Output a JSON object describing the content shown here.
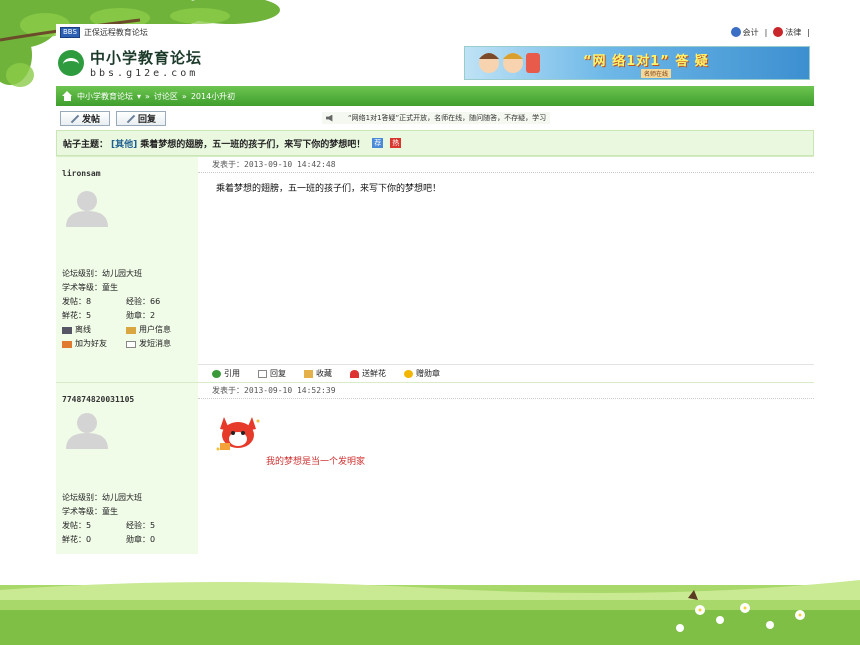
{
  "topbar": {
    "badge": "BBS",
    "site_label": "正保远程教育论坛",
    "link_accounting": "会计",
    "separator": "|",
    "link_law": "法律"
  },
  "header": {
    "logo_cn": "中小学教育论坛",
    "logo_en": "bbs.g12e.com",
    "banner_headline": "“网 络1对1” 答 疑",
    "banner_sub": "名师在线"
  },
  "nav": {
    "forum": "中小学教育论坛",
    "dropdown_arrow": "▾",
    "section_1": "讨论区",
    "separator": "»",
    "section_2": "2014小升初"
  },
  "actions": {
    "post_label": "发帖",
    "reply_label": "回复",
    "notice": "“网络1对1答疑”正式开放，名师在线，随问随答，不存疑，学习"
  },
  "thread": {
    "subject_label": "帖子主题：",
    "category": "[其他]",
    "title": "乘着梦想的翅膀，五一班的孩子们，来写下你的梦想吧！",
    "tag_1": "荐",
    "tag_2": "热"
  },
  "posts": [
    {
      "username": "lironsam",
      "posted_at": "发表于：2013-09-10 14:42:48",
      "body": "乘着梦想的翅膀，五一班的孩子们，来写下你的梦想吧！",
      "level": "论坛级别：幼儿园大班",
      "rank": "学术等级：童生",
      "posts": "发帖：8",
      "exp": "经验：66",
      "flowers": "鲜花：5",
      "medals": "勋章：2",
      "status": "离线",
      "user_info": "用户信息",
      "add_friend": "加为好友",
      "send_msg": "发短消息",
      "tools": [
        "引用",
        "回复",
        "收藏",
        "送鲜花",
        "赠勋章"
      ]
    },
    {
      "username": "774874820031105",
      "posted_at": "发表于：2013-09-10 14:52:39",
      "body": "我的梦想是当一个发明家",
      "level": "论坛级别：幼儿园大班",
      "rank": "学术等级：童生",
      "posts": "发帖：5",
      "exp": "经验：5",
      "flowers": "鲜花：0",
      "medals": "勋章：0"
    }
  ],
  "colors": {
    "nav_green": "#4caf3a",
    "post_side_bg": "#f0fbe8",
    "message_red": "#d03030"
  }
}
